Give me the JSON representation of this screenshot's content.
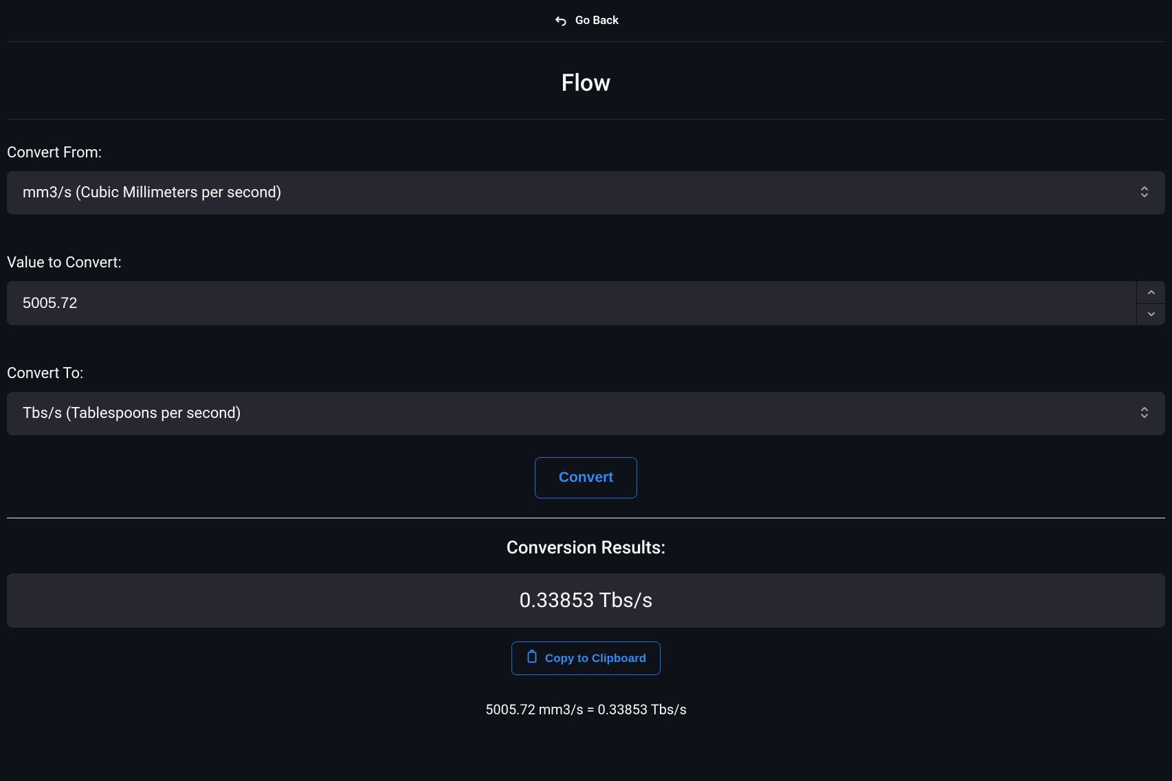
{
  "header": {
    "back_label": "Go Back"
  },
  "title": "Flow",
  "convert_from": {
    "label": "Convert From:",
    "value": "mm3/s (Cubic Millimeters per second)"
  },
  "value_to_convert": {
    "label": "Value to Convert:",
    "value": "5005.72"
  },
  "convert_to": {
    "label": "Convert To:",
    "value": "Tbs/s (Tablespoons per second)"
  },
  "convert_button": "Convert",
  "results": {
    "heading": "Conversion Results:",
    "value": "0.33853 Tbs/s",
    "copy_label": "Copy to Clipboard",
    "summary": "5005.72 mm3/s = 0.33853 Tbs/s"
  }
}
